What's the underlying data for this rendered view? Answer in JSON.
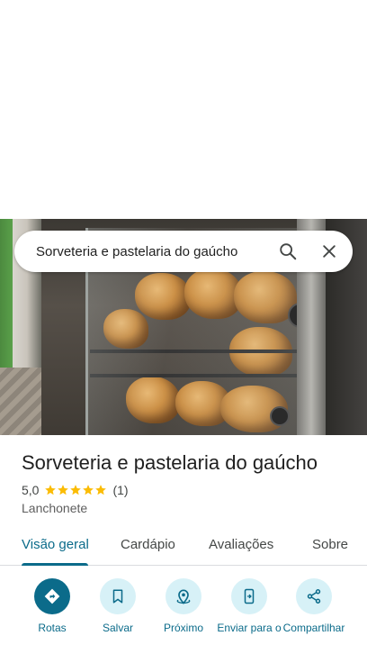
{
  "search": {
    "query": "Sorveteria e pastelaria do gaúcho"
  },
  "place": {
    "title": "Sorveteria e pastelaria do gaúcho",
    "rating": "5,0",
    "rating_value": 5,
    "review_count": "(1)",
    "category": "Lanchonete"
  },
  "tabs": [
    {
      "label": "Visão geral",
      "active": true
    },
    {
      "label": "Cardápio",
      "active": false
    },
    {
      "label": "Avaliações",
      "active": false
    },
    {
      "label": "Sobre",
      "active": false
    }
  ],
  "actions": [
    {
      "label": "Rotas",
      "icon": "directions-icon"
    },
    {
      "label": "Salvar",
      "icon": "bookmark-icon"
    },
    {
      "label": "Próximo",
      "icon": "nearby-icon"
    },
    {
      "label": "Enviar para o",
      "icon": "send-to-phone-icon"
    },
    {
      "label": "Compartilhar",
      "icon": "share-icon"
    }
  ],
  "colors": {
    "accent": "#0b6b8a",
    "action_bg": "#d7f1f7",
    "star": "#fbbc04"
  }
}
